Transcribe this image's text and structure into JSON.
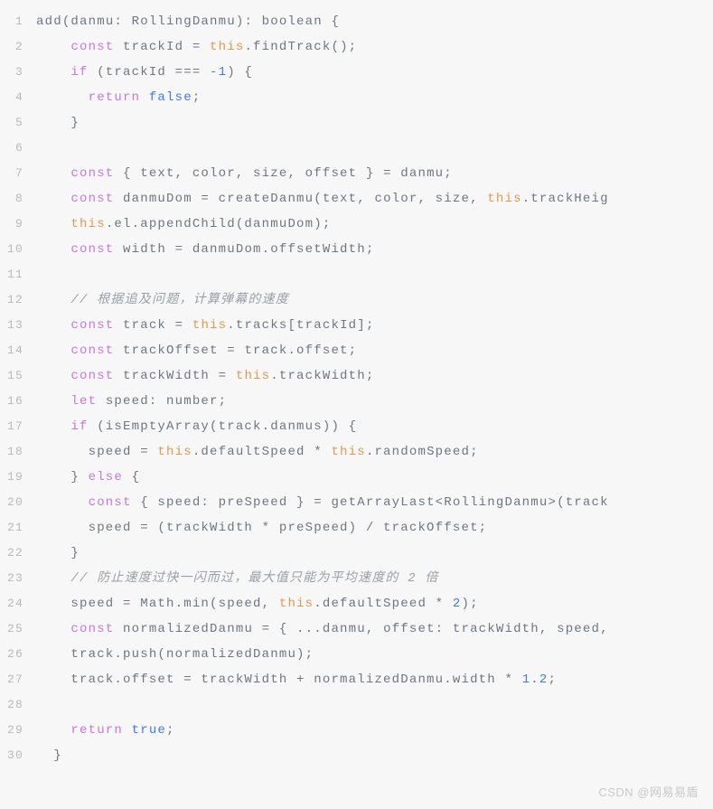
{
  "watermark": "CSDN @网易易盾",
  "lines": [
    {
      "n": 1,
      "tokens": [
        {
          "t": "add",
          "c": "plain"
        },
        {
          "t": "(danmu: RollingDanmu): boolean {",
          "c": "plain"
        }
      ]
    },
    {
      "n": 2,
      "tokens": [
        {
          "t": "    ",
          "c": "plain"
        },
        {
          "t": "const",
          "c": "kw"
        },
        {
          "t": " trackId = ",
          "c": "plain"
        },
        {
          "t": "this",
          "c": "this"
        },
        {
          "t": ".findTrack();",
          "c": "plain"
        }
      ]
    },
    {
      "n": 3,
      "tokens": [
        {
          "t": "    ",
          "c": "plain"
        },
        {
          "t": "if",
          "c": "kw"
        },
        {
          "t": " (trackId === ",
          "c": "plain"
        },
        {
          "t": "-1",
          "c": "num"
        },
        {
          "t": ") {",
          "c": "plain"
        }
      ]
    },
    {
      "n": 4,
      "tokens": [
        {
          "t": "      ",
          "c": "plain"
        },
        {
          "t": "return",
          "c": "kw"
        },
        {
          "t": " ",
          "c": "plain"
        },
        {
          "t": "false",
          "c": "num"
        },
        {
          "t": ";",
          "c": "plain"
        }
      ]
    },
    {
      "n": 5,
      "tokens": [
        {
          "t": "    }",
          "c": "plain"
        }
      ]
    },
    {
      "n": 6,
      "tokens": []
    },
    {
      "n": 7,
      "tokens": [
        {
          "t": "    ",
          "c": "plain"
        },
        {
          "t": "const",
          "c": "kw"
        },
        {
          "t": " { text, color, size, offset } = danmu;",
          "c": "plain"
        }
      ]
    },
    {
      "n": 8,
      "tokens": [
        {
          "t": "    ",
          "c": "plain"
        },
        {
          "t": "const",
          "c": "kw"
        },
        {
          "t": " danmuDom = createDanmu(text, color, size, ",
          "c": "plain"
        },
        {
          "t": "this",
          "c": "this"
        },
        {
          "t": ".trackHeig",
          "c": "plain"
        }
      ]
    },
    {
      "n": 9,
      "tokens": [
        {
          "t": "    ",
          "c": "plain"
        },
        {
          "t": "this",
          "c": "this"
        },
        {
          "t": ".el.appendChild(danmuDom);",
          "c": "plain"
        }
      ]
    },
    {
      "n": 10,
      "tokens": [
        {
          "t": "    ",
          "c": "plain"
        },
        {
          "t": "const",
          "c": "kw"
        },
        {
          "t": " width = danmuDom.offsetWidth;",
          "c": "plain"
        }
      ]
    },
    {
      "n": 11,
      "tokens": []
    },
    {
      "n": 12,
      "tokens": [
        {
          "t": "    ",
          "c": "plain"
        },
        {
          "t": "// 根据追及问题，计算弹幕的速度",
          "c": "cmt"
        }
      ]
    },
    {
      "n": 13,
      "tokens": [
        {
          "t": "    ",
          "c": "plain"
        },
        {
          "t": "const",
          "c": "kw"
        },
        {
          "t": " track = ",
          "c": "plain"
        },
        {
          "t": "this",
          "c": "this"
        },
        {
          "t": ".tracks[trackId];",
          "c": "plain"
        }
      ]
    },
    {
      "n": 14,
      "tokens": [
        {
          "t": "    ",
          "c": "plain"
        },
        {
          "t": "const",
          "c": "kw"
        },
        {
          "t": " trackOffset = track.offset;",
          "c": "plain"
        }
      ]
    },
    {
      "n": 15,
      "tokens": [
        {
          "t": "    ",
          "c": "plain"
        },
        {
          "t": "const",
          "c": "kw"
        },
        {
          "t": " trackWidth = ",
          "c": "plain"
        },
        {
          "t": "this",
          "c": "this"
        },
        {
          "t": ".trackWidth;",
          "c": "plain"
        }
      ]
    },
    {
      "n": 16,
      "tokens": [
        {
          "t": "    ",
          "c": "plain"
        },
        {
          "t": "let",
          "c": "kw"
        },
        {
          "t": " speed: number;",
          "c": "plain"
        }
      ]
    },
    {
      "n": 17,
      "tokens": [
        {
          "t": "    ",
          "c": "plain"
        },
        {
          "t": "if",
          "c": "kw"
        },
        {
          "t": " (isEmptyArray(track.danmus)) {",
          "c": "plain"
        }
      ]
    },
    {
      "n": 18,
      "tokens": [
        {
          "t": "      speed = ",
          "c": "plain"
        },
        {
          "t": "this",
          "c": "this"
        },
        {
          "t": ".defaultSpeed * ",
          "c": "plain"
        },
        {
          "t": "this",
          "c": "this"
        },
        {
          "t": ".randomSpeed;",
          "c": "plain"
        }
      ]
    },
    {
      "n": 19,
      "tokens": [
        {
          "t": "    } ",
          "c": "plain"
        },
        {
          "t": "else",
          "c": "kw"
        },
        {
          "t": " {",
          "c": "plain"
        }
      ]
    },
    {
      "n": 20,
      "tokens": [
        {
          "t": "      ",
          "c": "plain"
        },
        {
          "t": "const",
          "c": "kw"
        },
        {
          "t": " { speed: preSpeed } = getArrayLast<RollingDanmu>(track",
          "c": "plain"
        }
      ]
    },
    {
      "n": 21,
      "tokens": [
        {
          "t": "      speed = (trackWidth * preSpeed) / trackOffset;",
          "c": "plain"
        }
      ]
    },
    {
      "n": 22,
      "tokens": [
        {
          "t": "    }",
          "c": "plain"
        }
      ]
    },
    {
      "n": 23,
      "tokens": [
        {
          "t": "    ",
          "c": "plain"
        },
        {
          "t": "// 防止速度过快一闪而过，最大值只能为平均速度的 2 倍",
          "c": "cmt"
        }
      ]
    },
    {
      "n": 24,
      "tokens": [
        {
          "t": "    speed = Math.min(speed, ",
          "c": "plain"
        },
        {
          "t": "this",
          "c": "this"
        },
        {
          "t": ".defaultSpeed * ",
          "c": "plain"
        },
        {
          "t": "2",
          "c": "num"
        },
        {
          "t": ");",
          "c": "plain"
        }
      ]
    },
    {
      "n": 25,
      "tokens": [
        {
          "t": "    ",
          "c": "plain"
        },
        {
          "t": "const",
          "c": "kw"
        },
        {
          "t": " normalizedDanmu = { ...danmu, offset: trackWidth, speed,",
          "c": "plain"
        }
      ]
    },
    {
      "n": 26,
      "tokens": [
        {
          "t": "    track.push(normalizedDanmu);",
          "c": "plain"
        }
      ]
    },
    {
      "n": 27,
      "tokens": [
        {
          "t": "    track.offset = trackWidth + normalizedDanmu.width * ",
          "c": "plain"
        },
        {
          "t": "1.2",
          "c": "num"
        },
        {
          "t": ";",
          "c": "plain"
        }
      ]
    },
    {
      "n": 28,
      "tokens": []
    },
    {
      "n": 29,
      "tokens": [
        {
          "t": "    ",
          "c": "plain"
        },
        {
          "t": "return",
          "c": "kw"
        },
        {
          "t": " ",
          "c": "plain"
        },
        {
          "t": "true",
          "c": "num"
        },
        {
          "t": ";",
          "c": "plain"
        }
      ]
    },
    {
      "n": 30,
      "tokens": [
        {
          "t": "  }",
          "c": "plain"
        }
      ]
    }
  ]
}
